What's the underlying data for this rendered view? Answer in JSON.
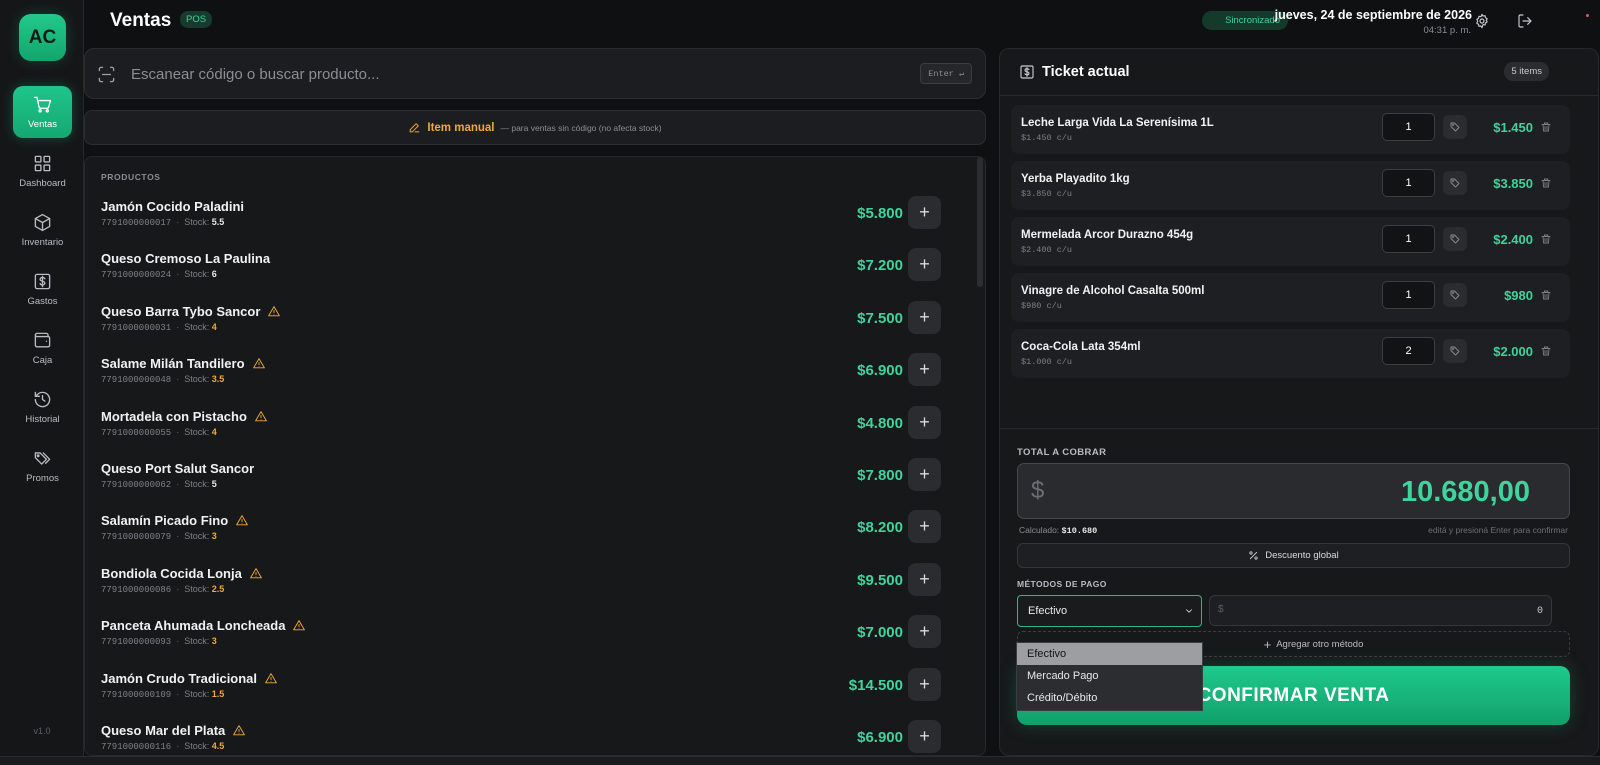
{
  "app": {
    "logo_text": "AC",
    "version": "v1.0"
  },
  "sidebar": {
    "items": [
      {
        "label": "Ventas",
        "icon": "cart-icon",
        "active": true
      },
      {
        "label": "Dashboard",
        "icon": "dashboard-icon",
        "active": false
      },
      {
        "label": "Inventario",
        "icon": "box-icon",
        "active": false
      },
      {
        "label": "Gastos",
        "icon": "dollar-icon",
        "active": false
      },
      {
        "label": "Caja",
        "icon": "wallet-icon",
        "active": false
      },
      {
        "label": "Historial",
        "icon": "history-icon",
        "active": false
      },
      {
        "label": "Promos",
        "icon": "tags-icon",
        "active": false
      }
    ]
  },
  "header": {
    "title": "Ventas",
    "badge": "POS",
    "sync_status": "Sincronizado",
    "date": "jueves, 24 de septiembre de 2026",
    "time": "04:31 p. m."
  },
  "search": {
    "placeholder": "Escanear código o buscar producto...",
    "enter_hint": "Enter ↵"
  },
  "manual_item": {
    "label": "Item manual",
    "note": "— para ventas sin código (no afecta stock)"
  },
  "products": {
    "header": "PRODUCTOS",
    "stock_label": "Stock:",
    "items": [
      {
        "name": "Jamón Cocido Paladini",
        "code": "7791000000017",
        "stock": "5.5",
        "low": false,
        "price": "$5.800"
      },
      {
        "name": "Queso Cremoso La Paulina",
        "code": "7791000000024",
        "stock": "6",
        "low": false,
        "price": "$7.200"
      },
      {
        "name": "Queso Barra Tybo Sancor",
        "code": "7791000000031",
        "stock": "4",
        "low": true,
        "price": "$7.500"
      },
      {
        "name": "Salame Milán Tandilero",
        "code": "7791000000048",
        "stock": "3.5",
        "low": true,
        "price": "$6.900"
      },
      {
        "name": "Mortadela con Pistacho",
        "code": "7791000000055",
        "stock": "4",
        "low": true,
        "price": "$4.800"
      },
      {
        "name": "Queso Port Salut Sancor",
        "code": "7791000000062",
        "stock": "5",
        "low": false,
        "price": "$7.800"
      },
      {
        "name": "Salamín Picado Fino",
        "code": "7791000000079",
        "stock": "3",
        "low": true,
        "price": "$8.200"
      },
      {
        "name": "Bondiola Cocida Lonja",
        "code": "7791000000086",
        "stock": "2.5",
        "low": true,
        "price": "$9.500"
      },
      {
        "name": "Panceta Ahumada Loncheada",
        "code": "7791000000093",
        "stock": "3",
        "low": true,
        "price": "$7.000"
      },
      {
        "name": "Jamón Crudo Tradicional",
        "code": "7791000000109",
        "stock": "1.5",
        "low": true,
        "price": "$14.500"
      },
      {
        "name": "Queso Mar del Plata",
        "code": "7791000000116",
        "stock": "4.5",
        "low": true,
        "price": "$6.900"
      }
    ]
  },
  "ticket": {
    "title": "Ticket actual",
    "count": "5 items",
    "items": [
      {
        "name": "Leche Larga Vida La Serenísima 1L",
        "unit": "$1.450 c/u",
        "qty": "1",
        "total": "$1.450"
      },
      {
        "name": "Yerba Playadito 1kg",
        "unit": "$3.850 c/u",
        "qty": "1",
        "total": "$3.850"
      },
      {
        "name": "Mermelada Arcor Durazno 454g",
        "unit": "$2.400 c/u",
        "qty": "1",
        "total": "$2.400"
      },
      {
        "name": "Vinagre de Alcohol Casalta 500ml",
        "unit": "$980 c/u",
        "qty": "1",
        "total": "$980"
      },
      {
        "name": "Coca-Cola Lata 354ml",
        "unit": "$1.000 c/u",
        "qty": "2",
        "total": "$2.000"
      }
    ],
    "total_label": "TOTAL A COBRAR",
    "currency": "$",
    "total_value": "10.680,00",
    "calc_label": "Calculado:",
    "calc_value": "$10.680",
    "hint": "editá y presioná Enter para confirmar",
    "discount_label": "Descuento global",
    "payment_label": "MÉTODOS DE PAGO",
    "payment_selected": "Efectivo",
    "payment_options": [
      "Efectivo",
      "Mercado Pago",
      "Crédito/Débito"
    ],
    "amount_currency": "$",
    "amount_value": "0",
    "add_method_label": "Agregar otro método",
    "confirm_label": "CONFIRMAR VENTA"
  },
  "colors": {
    "accent": "#1fc58a",
    "price": "#3fd49b",
    "warning": "#f0a93a"
  }
}
